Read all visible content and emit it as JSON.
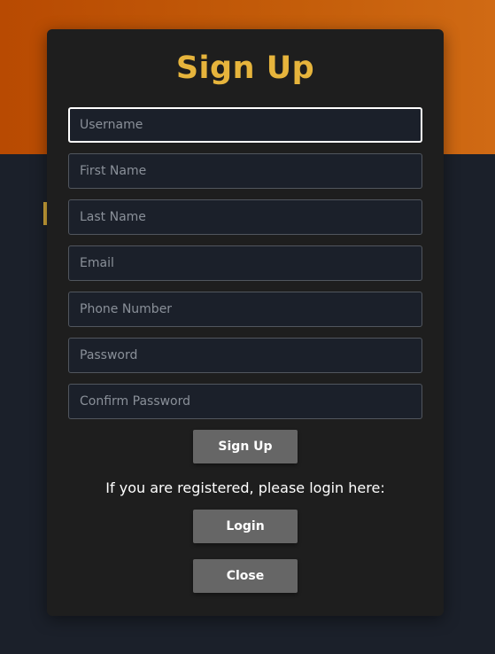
{
  "modal": {
    "title": "Sign Up",
    "fields": {
      "username_placeholder": "Username",
      "first_name_placeholder": "First Name",
      "last_name_placeholder": "Last Name",
      "email_placeholder": "Email",
      "phone_placeholder": "Phone Number",
      "password_placeholder": "Password",
      "confirm_password_placeholder": "Confirm Password"
    },
    "signup_button": "Sign Up",
    "login_prompt": "If you are registered, please login here:",
    "login_button": "Login",
    "close_button": "Close"
  },
  "colors": {
    "hero_orange": "#c45d0a",
    "title_gold": "#e6b43c",
    "modal_bg": "#1e1e1e",
    "page_bg": "#1b202a",
    "button_gray": "#666666"
  }
}
